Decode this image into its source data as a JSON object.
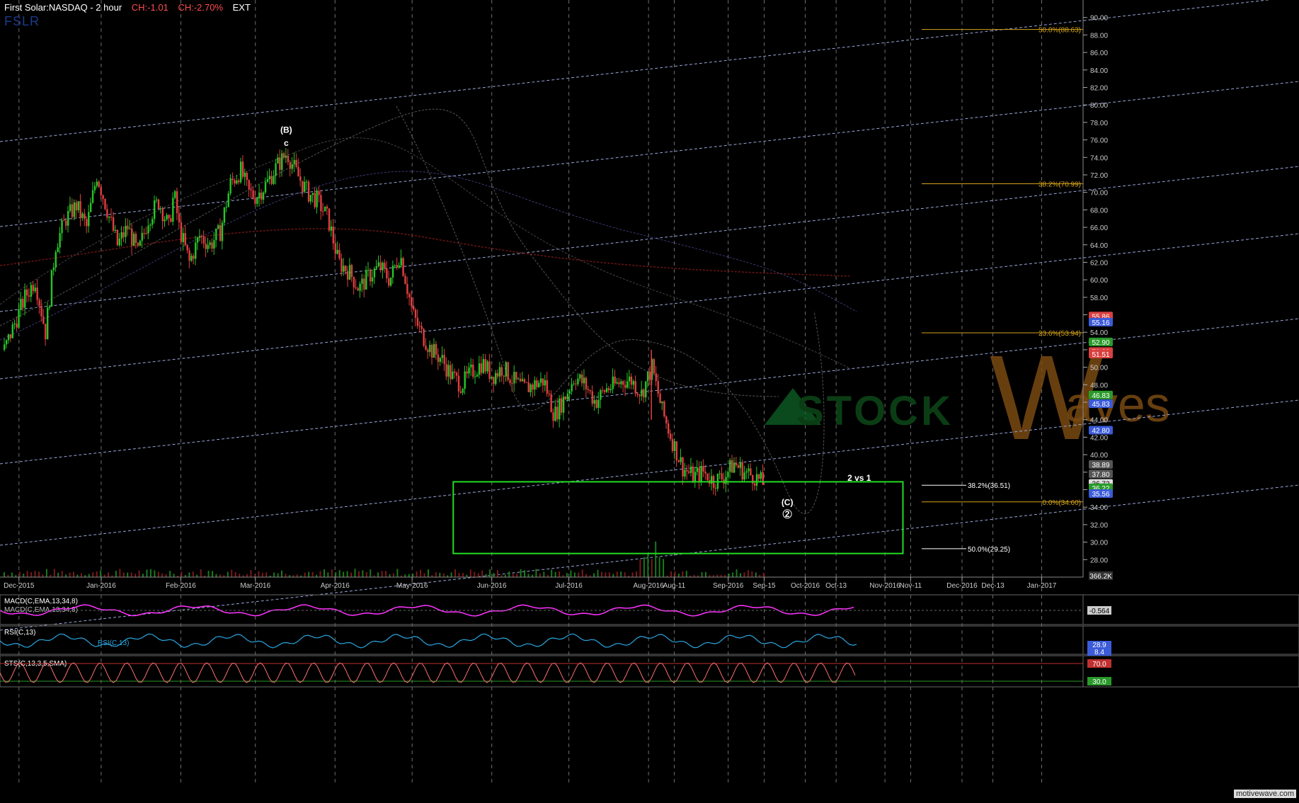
{
  "header": {
    "symbol": "First Solar:NASDAQ - 2 hour",
    "change_abs": "CH:-1.01",
    "change_pct": "CH:-2.70%",
    "session": "EXT",
    "ticker_watermark": "FSLR"
  },
  "colors": {
    "background": "#000000",
    "up_candle": "#27c627",
    "down_candle": "#e04040",
    "fib": "#d4a21a",
    "trend_channel": "#9aa6d8",
    "target_box": "#22dd22",
    "grid_vertical": "#8a8a8a",
    "macd": "#ff33ff",
    "rsi": "#2aa6e0",
    "stoch": "#ff7070",
    "watermark": "#7a4a12"
  },
  "watermark": {
    "left": "STOCK",
    "big": "W",
    "right": "aves"
  },
  "price_axis": {
    "min": 26,
    "max": 92,
    "ticks": [
      "28.00",
      "30.00",
      "32.00",
      "34.00",
      "36.00",
      "38.00",
      "40.00",
      "42.00",
      "44.00",
      "46.00",
      "48.00",
      "50.00",
      "52.00",
      "54.00",
      "56.00",
      "58.00",
      "60.00",
      "62.00",
      "64.00",
      "66.00",
      "68.00",
      "70.00",
      "72.00",
      "74.00",
      "76.00",
      "78.00",
      "80.00",
      "82.00",
      "84.00",
      "86.00",
      "88.00",
      "90.00"
    ],
    "badges": [
      {
        "label": "55.86",
        "value": 55.86,
        "color": "#d94040"
      },
      {
        "label": "55.16",
        "value": 55.16,
        "color": "#3b5bd9"
      },
      {
        "label": "52.90",
        "value": 52.9,
        "color": "#2a9a2a"
      },
      {
        "label": "51.80",
        "value": 51.8,
        "color": "#d94040"
      },
      {
        "label": "51.51",
        "value": 51.51,
        "color": "#d94040"
      },
      {
        "label": "46.83",
        "value": 46.83,
        "color": "#2a9a2a"
      },
      {
        "label": "45.83",
        "value": 45.83,
        "color": "#3b5bd9"
      },
      {
        "label": "42.80",
        "value": 42.8,
        "color": "#3b5bd9"
      },
      {
        "label": "38.89",
        "value": 38.89,
        "color": "#555555"
      },
      {
        "label": "37.80",
        "value": 37.8,
        "color": "#555555"
      },
      {
        "label": "36.72",
        "value": 36.72,
        "color": "#dddddd"
      },
      {
        "label": "36.22",
        "value": 36.22,
        "color": "#2a9a2a"
      },
      {
        "label": "35.56",
        "value": 35.56,
        "color": "#3b5bd9"
      }
    ],
    "volume_label": "366.2K"
  },
  "time_axis": {
    "labels": [
      "Dec-2015",
      "Jan-2016",
      "Feb-2016",
      "Mar-2016",
      "Apr-2016",
      "May-2016",
      "Jun-2016",
      "Jul-2016",
      "Aug-2016",
      "Aug-11",
      "Sep-2016",
      "Sep-15",
      "Oct-2016",
      "Oct-13",
      "Nov-2016",
      "Nov-11",
      "Dec-2016",
      "Dec-13",
      "Jan-2017"
    ],
    "label_days": [
      6,
      38,
      69,
      98,
      129,
      159,
      190,
      220,
      251,
      261,
      282,
      296,
      312,
      324,
      343,
      353,
      373,
      385,
      404
    ]
  },
  "fib_levels": [
    {
      "label": "50.0%(88.63)",
      "value": 88.63
    },
    {
      "label": "38.2%(70.99)",
      "value": 70.99
    },
    {
      "label": "23.6%(53.94)",
      "value": 53.94
    },
    {
      "label": "0.0%(34.60)",
      "value": 34.6
    }
  ],
  "target_levels": [
    {
      "label": "38.2%(36.51)",
      "value": 36.51
    },
    {
      "label": "50.0%(29.25)",
      "value": 29.25
    }
  ],
  "target_box": {
    "start_day": 175,
    "end_day": 350,
    "top": 36.9,
    "bottom": 28.7
  },
  "wave_labels": [
    {
      "text": "(B)",
      "day": 110,
      "value": 76.8
    },
    {
      "text": "c",
      "day": 110,
      "value": 75.3
    },
    {
      "text": "2 vs 1",
      "day": 333,
      "value": 37.0
    },
    {
      "text": "(C)",
      "day": 305,
      "value": 34.2
    },
    {
      "text": "2",
      "day": 305,
      "value": 32.9
    }
  ],
  "indicators": {
    "macd": {
      "label": "MACD(C,EMA,13,34,8)",
      "sub": "MACD(C,EMA,13,34,8)",
      "value": "-0.564"
    },
    "rsi": {
      "label": "RSI(C,13)",
      "sub": "RSI(C,13)",
      "values": [
        "28.9",
        "8.4"
      ]
    },
    "stoch": {
      "label": "STS(C,13,3,5,SMA)",
      "levels": [
        "70.0",
        "30.0"
      ]
    }
  },
  "footer": {
    "brand": "motivewave.com"
  },
  "chart_data": {
    "type": "line",
    "title": "First Solar:NASDAQ - 2 hour",
    "xlabel": "",
    "ylabel": "",
    "ylim": [
      26,
      92
    ],
    "x_unit": "calendar day from 2015-11-25",
    "series": [
      {
        "x": [
          0,
          4,
          8,
          12,
          16,
          20,
          24,
          28,
          32,
          36,
          40,
          44,
          48,
          52,
          56,
          60,
          64,
          66,
          68,
          72,
          76,
          80,
          84,
          88,
          92,
          95,
          98,
          102,
          106,
          110,
          114,
          118,
          122,
          126,
          130,
          134,
          138,
          142,
          146,
          150,
          154,
          159,
          162,
          166,
          170,
          174,
          178,
          182,
          186,
          190,
          194,
          198,
          202,
          206,
          210,
          214,
          218,
          222,
          226,
          230,
          234,
          238,
          241,
          244,
          248,
          252,
          256,
          260,
          264,
          268,
          272,
          276,
          280,
          284,
          288,
          292,
          296
        ],
        "values": [
          52.0,
          55.0,
          58.0,
          60.0,
          54.0,
          64.0,
          67.0,
          68.5,
          66.0,
          72.0,
          68.0,
          64.0,
          66.0,
          63.0,
          67.0,
          69.0,
          66.0,
          70.0,
          66.0,
          62.0,
          65.0,
          64.0,
          65.5,
          71.0,
          72.5,
          70.0,
          69.5,
          71.0,
          73.0,
          74.5,
          72.0,
          70.0,
          69.0,
          67.0,
          62.0,
          61.0,
          59.0,
          60.5,
          61.5,
          60.0,
          63.0,
          56.0,
          54.0,
          52.0,
          51.0,
          49.0,
          48.0,
          49.5,
          50.5,
          49.0,
          50.0,
          48.5,
          47.5,
          48.0,
          48.5,
          44.5,
          46.5,
          49.0,
          48.0,
          46.0,
          47.5,
          48.0,
          48.5,
          48.5,
          47.0,
          50.0,
          45.0,
          41.5,
          38.5,
          37.5,
          38.0,
          37.0,
          37.5,
          39.0,
          38.0,
          37.5,
          36.5
        ]
      }
    ],
    "volume": {
      "unit": "shares",
      "max_label": "366.2K"
    }
  }
}
